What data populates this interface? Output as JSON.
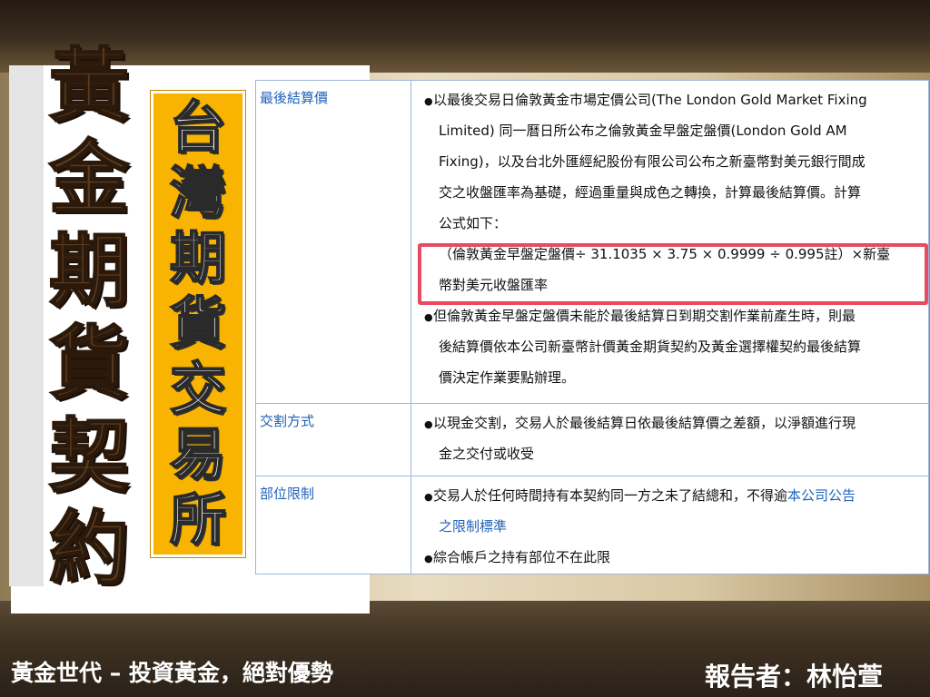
{
  "main_title": [
    "黃",
    "金",
    "期",
    "貨",
    "契",
    "約"
  ],
  "badge_title": [
    "台",
    "灣",
    "期",
    "貨",
    "交",
    "易",
    "所"
  ],
  "table": {
    "settlement": {
      "label": "最後結算價",
      "lines": [
        "以最後交易日倫敦黃金市場定價公司(The London Gold Market Fixing",
        "Limited) 同一曆日所公布之倫敦黃金早盤定盤價(London Gold AM",
        "Fixing)，以及台北外匯經紀股份有限公司公布之新臺幣對美元銀行間成",
        "交之收盤匯率為基礎，經過重量與成色之轉換，計算最後結算價。計算",
        "公式如下：",
        "（倫敦黃金早盤定盤價÷ 31.1035 × 3.75 × 0.9999 ÷ 0.995註）×新臺",
        "幣對美元收盤匯率",
        "但倫敦黃金早盤定盤價未能於最後結算日到期交割作業前產生時，則最",
        "後結算價依本公司新臺幣計價黃金期貨契約及黃金選擇權契約最後結算",
        "價決定作業要點辦理。"
      ]
    },
    "delivery": {
      "label": "交割方式",
      "lines": [
        "以現金交割，交易人於最後結算日依最後結算價之差額，以淨額進行現",
        "金之交付或收受"
      ]
    },
    "position_limit": {
      "label": "部位限制",
      "line1_text": "交易人於任何時間持有本契約同一方之未了結總和，不得逾",
      "line1_link": "本公司公告",
      "line2_link": "之限制標準",
      "line3": "綜合帳戶之持有部位不在此限"
    },
    "bullet": "●"
  },
  "footer": {
    "left": "黃金世代 – 投資黃金，絕對優勢",
    "right": "報告者：林怡萱"
  },
  "colors": {
    "accent_gold": "#f8b400",
    "title_brown": "#5a3a1e",
    "label_blue": "#1f62b8",
    "highlight_red": "#e84a5f"
  }
}
